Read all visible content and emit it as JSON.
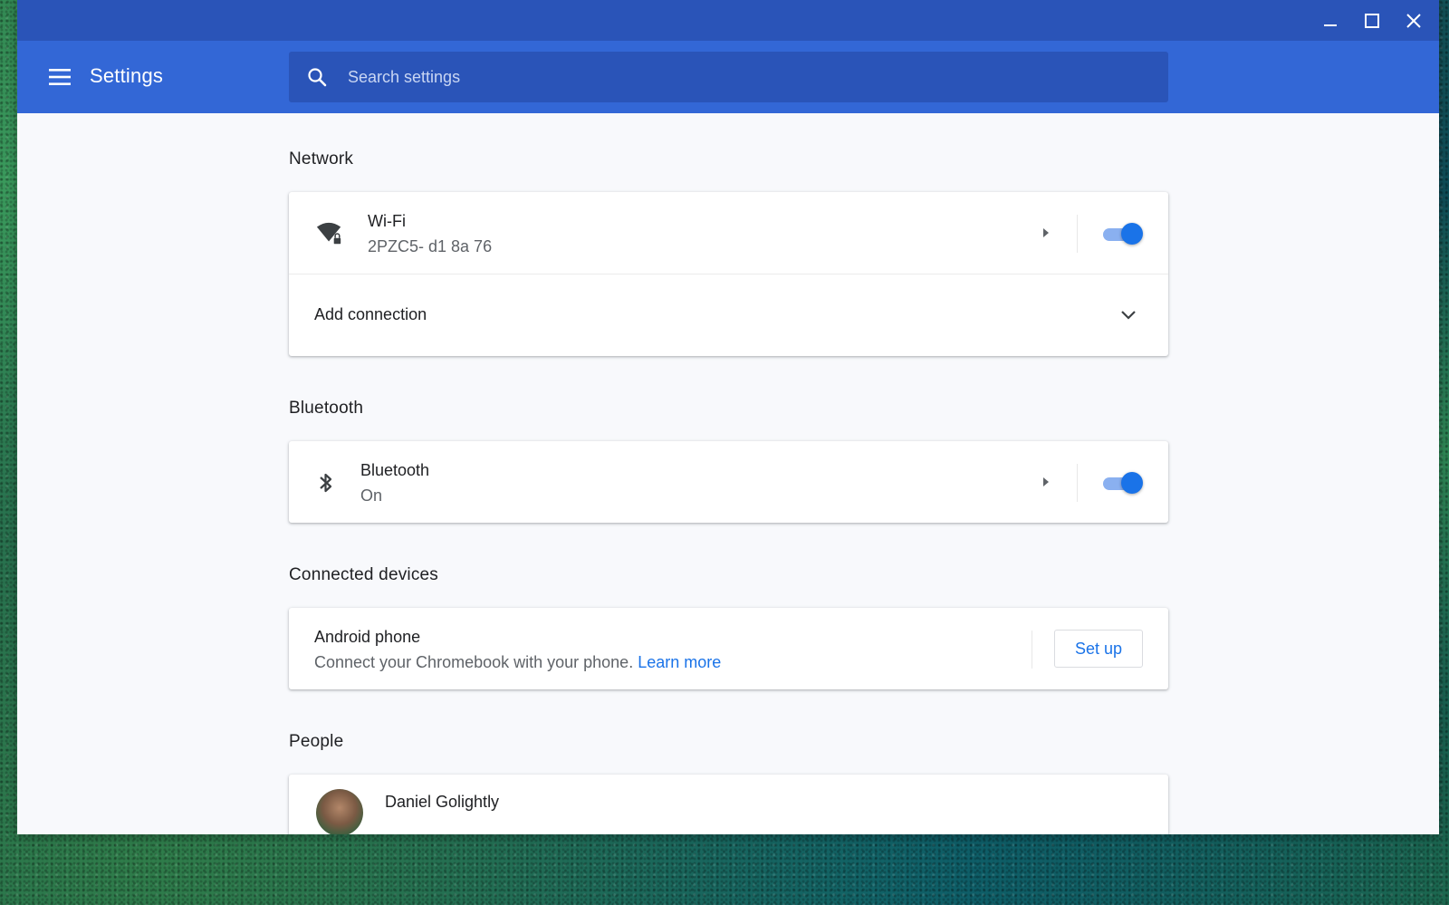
{
  "window": {
    "minimize_icon": "minimize-icon",
    "maximize_icon": "maximize-icon",
    "close_icon": "close-icon"
  },
  "header": {
    "title": "Settings",
    "menu_icon": "hamburger-menu-icon",
    "search": {
      "placeholder": "Search settings",
      "value": "",
      "icon": "search-icon"
    }
  },
  "sections": {
    "network": {
      "title": "Network",
      "wifi": {
        "label": "Wi-Fi",
        "status": "2PZC5- d1 8a 76",
        "icon": "wifi-secure-icon",
        "enabled": true
      },
      "add_connection": {
        "label": "Add connection",
        "icon": "chevron-down-icon"
      }
    },
    "bluetooth": {
      "title": "Bluetooth",
      "item": {
        "label": "Bluetooth",
        "status": "On",
        "icon": "bluetooth-icon",
        "enabled": true
      }
    },
    "connected_devices": {
      "title": "Connected devices",
      "android": {
        "label": "Android phone",
        "description": "Connect your Chromebook with your phone.",
        "link": "Learn more",
        "button": "Set up"
      }
    },
    "people": {
      "title": "People",
      "user": {
        "name": "Daniel Golightly"
      }
    }
  },
  "colors": {
    "titlebar": "#2a54b8",
    "appbar": "#3367d6",
    "accent": "#1a73e8",
    "background": "#f8f9fc"
  }
}
